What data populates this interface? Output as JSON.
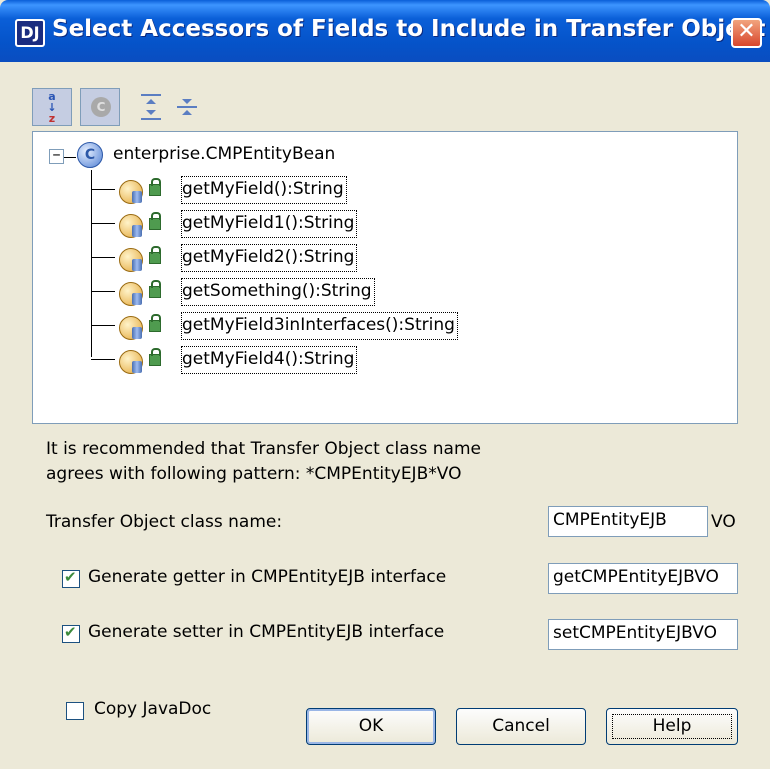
{
  "window": {
    "title": "Select Accessors of Fields to Include in Transfer Object",
    "app_icon_glyph": "DJ",
    "close_glyph": "✕"
  },
  "toolbar": {
    "sort_alpha_glyph": "a↓z",
    "hide_inherited_glyph": "C",
    "expand_all_icon": "expand-all-icon",
    "collapse_all_icon": "collapse-all-icon"
  },
  "tree": {
    "root": {
      "expander": "−",
      "icon_glyph": "C",
      "label": "enterprise.CMPEntityBean"
    },
    "methods": [
      "getMyField():String",
      "getMyField1():String",
      "getMyField2():String",
      "getSomething():String",
      "getMyField3inInterfaces():String",
      "getMyField4():String"
    ]
  },
  "info": {
    "line1": "It is recommended that Transfer Object class name",
    "line2": "agrees with following pattern: *CMPEntityEJB*VO"
  },
  "class_name": {
    "label": "Transfer Object class name:",
    "value": "CMPEntityEJB",
    "suffix": "VO"
  },
  "getter": {
    "checked": true,
    "label": "Generate getter in CMPEntityEJB interface",
    "value": "getCMPEntityEJBVO"
  },
  "setter": {
    "checked": true,
    "label": "Generate setter in CMPEntityEJB interface",
    "value": "setCMPEntityEJBVO"
  },
  "javadoc": {
    "checked": false,
    "label": "Copy JavaDoc"
  },
  "buttons": {
    "ok": "OK",
    "cancel": "Cancel",
    "help": "Help"
  },
  "colors": {
    "titlebar": "#0A5FD8",
    "dialog_bg": "#ECE9D8",
    "close_button": "#D8462C"
  }
}
